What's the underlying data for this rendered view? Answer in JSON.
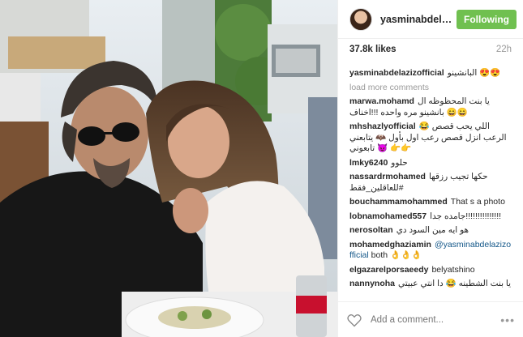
{
  "post": {
    "username": "yasminabdelaziz...",
    "follow_label": "Following",
    "likes": "37.8k likes",
    "time": "22h",
    "load_more": "load more comments",
    "add_comment_placeholder": "Add a comment...",
    "more_label": "•••"
  },
  "comments": [
    {
      "user": "yasminabdelazizofficial",
      "text": "البانشينو 😍😍"
    },
    {
      "user": "marwa.mohamd",
      "text": "يا بنت المحظوظه ال بانشينو مره واحده !!!اخناف 😄😄"
    },
    {
      "user": "mhshazlyofficial",
      "text": "😂 اللي يحب قصص الرعب انزل قصص رعب اول بأول 🦇 يتابعني 😈 تابعوني 👉👉"
    },
    {
      "user": "lmky6240",
      "text": "حلوو"
    },
    {
      "user": "nassardrmohamed",
      "text": "حكها تجيب رزقها #للعاقلين_فقط"
    },
    {
      "user": "bouchammamohammed",
      "text": "That s a photo"
    },
    {
      "user": "lobnamohamed557",
      "text": "جامده جدا!!!!!!!!!!!!!!!"
    },
    {
      "user": "nerosoltan",
      "text": "هو ايه مين السود دي"
    },
    {
      "user": "mohamedghaziamin",
      "mention": "@yasminabdelazizofficial",
      "text": "both 👌👌👌"
    },
    {
      "user": "elgazarelporsaeedy",
      "text": "belyatshino"
    },
    {
      "user": "nannynoha",
      "text": "يا بنت الشطينه 😂 دا انتي عبيتي"
    }
  ]
}
